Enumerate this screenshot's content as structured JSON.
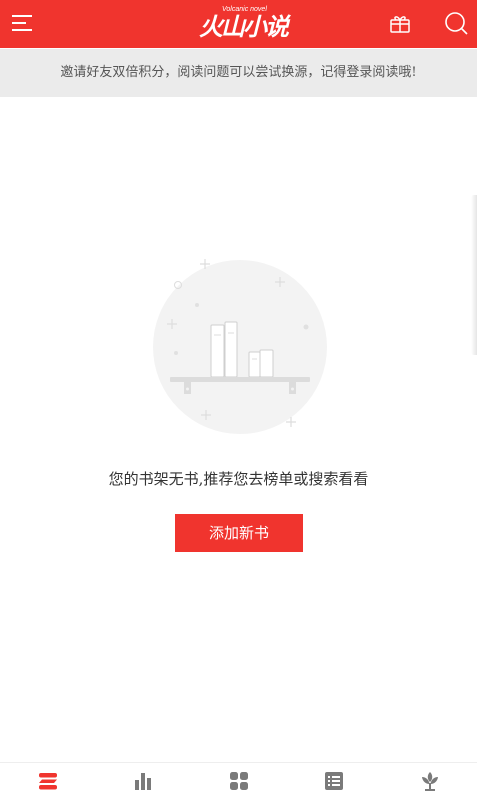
{
  "header": {
    "logo_text": "火山小说",
    "logo_subtext": "Volcanic novel",
    "menu_icon": "menu-icon",
    "gift_icon": "gift-icon",
    "search_icon": "search-icon",
    "bg_color": "#f0342e"
  },
  "notice": {
    "text": "邀请好友双倍积分，阅读问题可以尝试换源，记得登录阅读哦!"
  },
  "empty_state": {
    "icon": "empty-bookshelf-illustration",
    "message": "您的书架无书,推荐您去榜单或搜索看看",
    "add_button_label": "添加新书"
  },
  "tabs": [
    {
      "icon": "bookshelf-icon",
      "active": true
    },
    {
      "icon": "ranking-icon",
      "active": false
    },
    {
      "icon": "category-icon",
      "active": false
    },
    {
      "icon": "list-icon",
      "active": false
    },
    {
      "icon": "discover-icon",
      "active": false
    }
  ],
  "colors": {
    "accent": "#f0342e",
    "inactive_icon": "#7a7a7a"
  }
}
